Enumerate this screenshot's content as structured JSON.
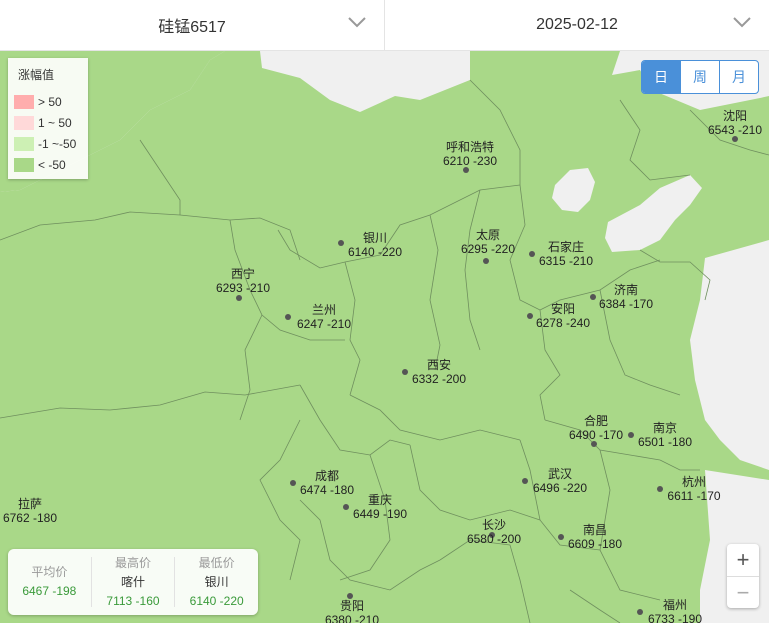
{
  "header": {
    "product": "硅锰6517",
    "date": "2025-02-12"
  },
  "legend": {
    "title": "涨幅值",
    "items": [
      {
        "label": "> 50",
        "color": "#ffadad"
      },
      {
        "label": "1 ~ 50",
        "color": "#ffd9d9"
      },
      {
        "label": "-1 ~-50",
        "color": "#cdf0b4"
      },
      {
        "label": "< -50",
        "color": "#a9d888"
      }
    ]
  },
  "period_tabs": [
    {
      "label": "日",
      "active": true
    },
    {
      "label": "周",
      "active": false
    },
    {
      "label": "月",
      "active": false
    }
  ],
  "map": {
    "region_color": "#a9d888",
    "background_color": "#f0f0f0",
    "cities": [
      {
        "name": "沈阳",
        "price": "6543",
        "change": "-210"
      },
      {
        "name": "呼和浩特",
        "price": "6210",
        "change": "-230"
      },
      {
        "name": "银川",
        "price": "6140",
        "change": "-220"
      },
      {
        "name": "太原",
        "price": "6295",
        "change": "-220"
      },
      {
        "name": "石家庄",
        "price": "6315",
        "change": "-210"
      },
      {
        "name": "西宁",
        "price": "6293",
        "change": "-210"
      },
      {
        "name": "济南",
        "price": "6384",
        "change": "-170"
      },
      {
        "name": "兰州",
        "price": "6247",
        "change": "-210"
      },
      {
        "name": "安阳",
        "price": "6278",
        "change": "-240"
      },
      {
        "name": "西安",
        "price": "6332",
        "change": "-200"
      },
      {
        "name": "合肥",
        "price": "6490",
        "change": "-170"
      },
      {
        "name": "南京",
        "price": "6501",
        "change": "-180"
      },
      {
        "name": "成都",
        "price": "6474",
        "change": "-180"
      },
      {
        "name": "武汉",
        "price": "6496",
        "change": "-220"
      },
      {
        "name": "杭州",
        "price": "6611",
        "change": "-170"
      },
      {
        "name": "拉萨",
        "price": "6762",
        "change": "-180"
      },
      {
        "name": "重庆",
        "price": "6449",
        "change": "-190"
      },
      {
        "name": "长沙",
        "price": "6580",
        "change": "-200"
      },
      {
        "name": "南昌",
        "price": "6609",
        "change": "-180"
      },
      {
        "name": "贵阳",
        "price": "6380",
        "change": "-210"
      },
      {
        "name": "福州",
        "price": "6733",
        "change": "-190"
      }
    ]
  },
  "zoom": {
    "in": "+",
    "out": "−"
  },
  "stats": [
    {
      "caption": "平均价",
      "name": "",
      "value": "6467 -198"
    },
    {
      "caption": "最高价",
      "name": "喀什",
      "value": "7113 -160"
    },
    {
      "caption": "最低价",
      "name": "银川",
      "value": "6140 -220"
    }
  ],
  "colors": {
    "accent": "#4a90d9",
    "down_text": "#3a9a3a"
  }
}
